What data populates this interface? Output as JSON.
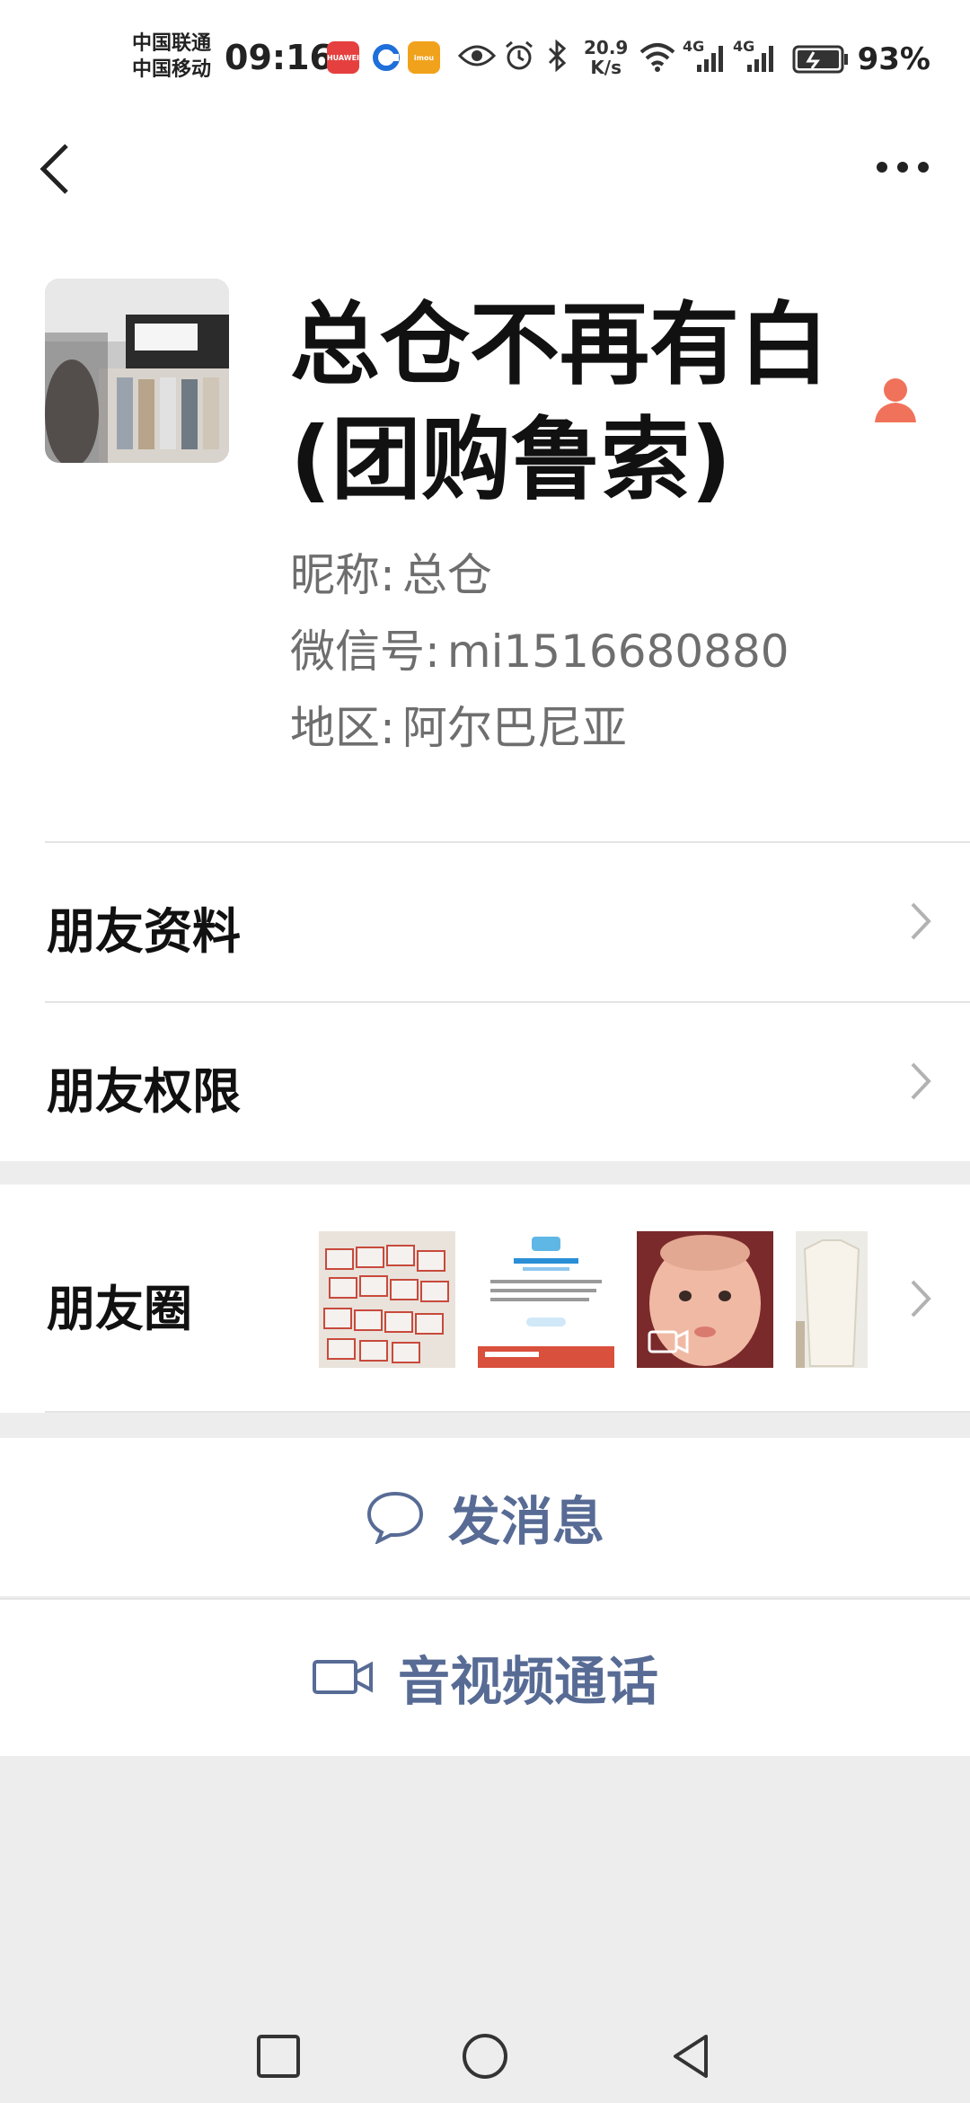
{
  "status_bar": {
    "carrier_1": "中国联通",
    "carrier_2": "中国移动",
    "time": "09:16",
    "app_icons": [
      "HUAWEI",
      "imou"
    ],
    "net_speed_value": "20.9",
    "net_speed_unit": "K/s",
    "signal_1": "4G",
    "signal_2": "4G",
    "battery": "93%"
  },
  "nav": {
    "back_icon": "chevron-left-icon",
    "more_icon": "more-dots-icon"
  },
  "profile": {
    "remark_name": "总仓不再有白(团购鲁索)",
    "nickname_label": "昵称:",
    "nickname": "总仓",
    "wechat_id_label": "微信号:",
    "wechat_id": "mi1516680880",
    "region_label": "地区:",
    "region": "阿尔巴尼亚",
    "contact_tag_icon": "person-icon",
    "contact_tag_color": "#f0725a"
  },
  "rows": {
    "friend_profile": "朋友资料",
    "friend_permissions": "朋友权限",
    "moments": "朋友圈"
  },
  "actions": {
    "send_message": "发消息",
    "video_call": "音视频通话",
    "accent_color": "#576b95"
  }
}
